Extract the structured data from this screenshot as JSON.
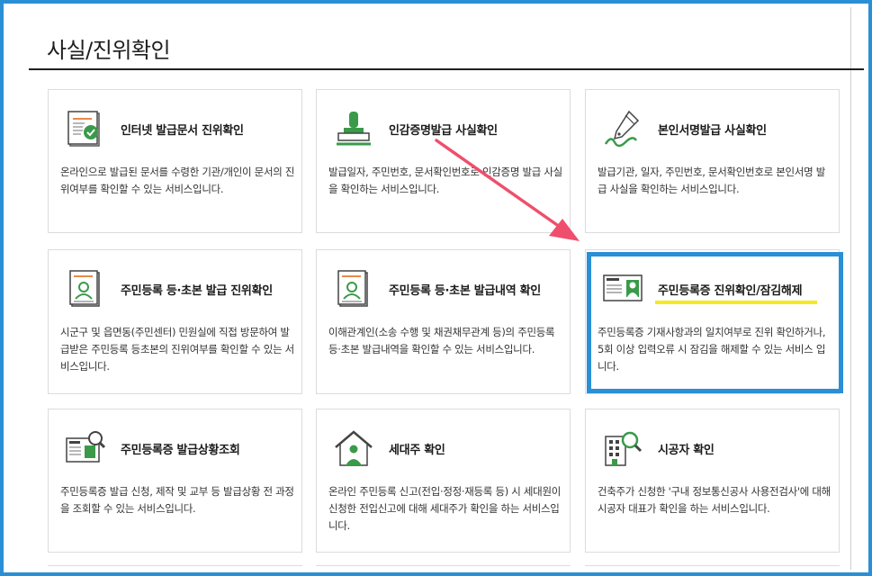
{
  "page": {
    "title": "사실/진위확인"
  },
  "cards": [
    {
      "title": "인터넷 발급문서 진위확인",
      "desc": "온라인으로 발급된 문서를 수령한 기관/개인이 문서의 진위여부를 확인할 수 있는 서비스입니다.",
      "icon": "document-check-icon"
    },
    {
      "title": "인감증명발급 사실확인",
      "desc": "발급일자, 주민번호, 문서확인번호로 인감증명 발급 사실을 확인하는 서비스입니다.",
      "icon": "stamp-icon"
    },
    {
      "title": "본인서명발급 사실확인",
      "desc": "발급기관, 일자, 주민번호, 문서확인번호로 본인서명 발급 사실을 확인하는 서비스입니다.",
      "icon": "pen-signature-icon"
    },
    {
      "title": "주민등록 등·초본 발급 진위확인",
      "desc": "시군구 및 읍면동(주민센터) 민원실에 직접 방문하여 발급받은 주민등록 등초본의 진위여부를 확인할 수 있는 서비스입니다.",
      "icon": "resident-document-icon"
    },
    {
      "title": "주민등록 등·초본 발급내역 확인",
      "desc": "이해관계인(소송 수행 및 채권채무관계 등)의 주민등록 등·초본 발급내역을 확인할 수 있는 서비스입니다.",
      "icon": "resident-history-icon"
    },
    {
      "title": "주민등록증 진위확인/잠김해제",
      "desc": "주민등록증 기재사항과의 일치여부로 진위 확인하거나, 5회 이상 입력오류 시 잠김을 해제할 수 있는 서비스 입니다.",
      "icon": "id-card-icon"
    },
    {
      "title": "주민등록증 발급상황조회",
      "desc": "주민등록증 발급 신청, 제작 및 교부 등 발급상황 전 과정을 조회할 수 있는 서비스입니다.",
      "icon": "id-card-search-icon"
    },
    {
      "title": "세대주 확인",
      "desc": "온라인 주민등록 신고(전입·정정·재등록 등) 시 세대원이 신청한 전입신고에 대해 세대주가 확인을 하는 서비스입니다.",
      "icon": "house-person-icon"
    },
    {
      "title": "시공자 확인",
      "desc": "건축주가 신청한 '구내 정보통신공사 사용전검사'에 대해 시공자 대표가 확인을 하는 서비스입니다.",
      "icon": "building-search-icon"
    }
  ],
  "colors": {
    "frame_blue": "#2b8fd6",
    "arrow_pink": "#ef4f6c",
    "highlight_yellow": "#f4ea1e",
    "icon_green": "#3a9a4a",
    "icon_orange": "#e88a4a"
  }
}
